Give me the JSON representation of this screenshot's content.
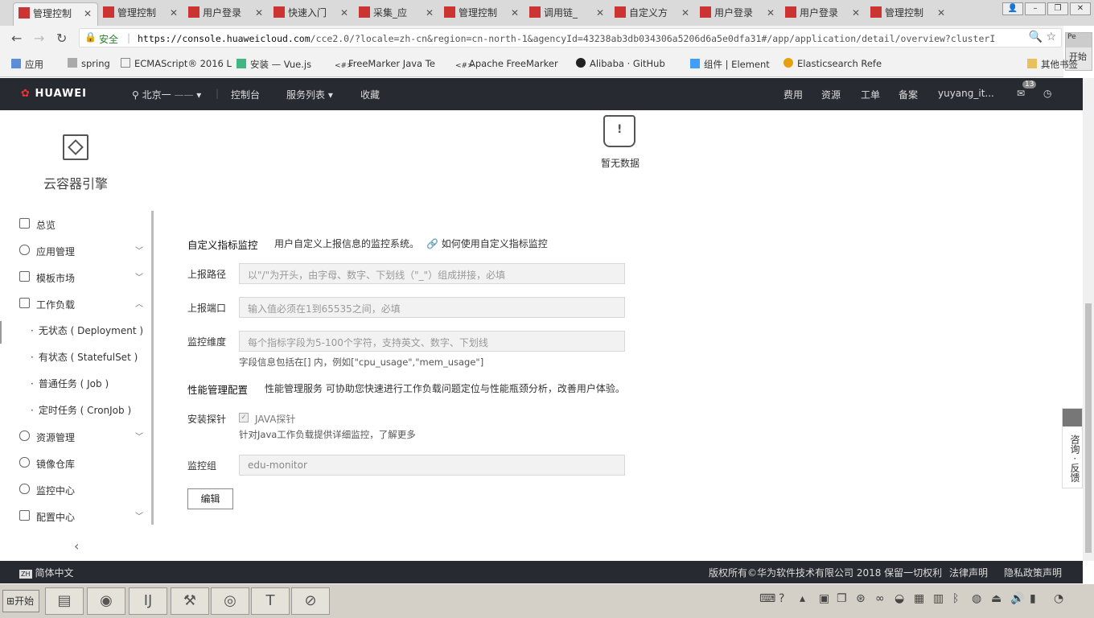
{
  "browser": {
    "tabs": [
      "管理控制",
      "管理控制",
      "用户登录",
      "快速入门",
      "采集_应",
      "管理控制",
      "调用链_",
      "自定义方",
      "用户登录",
      "用户登录",
      "管理控制"
    ],
    "secure_label": "安全",
    "url_host": "https://console.huaweicloud.com",
    "url_path": "/cce2.0/?locale=zh-cn&region=cn-north-1&agencyId=43238ab3db034306a5206d6a5e0dfa31#/app/application/detail/overview?clusterI",
    "extension_label": "开始",
    "bookmarks": [
      "应用",
      "spring",
      "ECMAScript® 2016 L",
      "安装 — Vue.js",
      "FreeMarker Java Te",
      "Apache FreeMarker",
      "Alibaba · GitHub",
      "组件 | Element",
      "Elasticsearch Refe",
      "其他书签"
    ]
  },
  "topnav": {
    "logo": "HUAWEI",
    "region": "北京一",
    "console": "控制台",
    "services": "服务列表",
    "favorites": "收藏",
    "billing": "费用",
    "resources": "资源",
    "tickets": "工单",
    "filing": "备案",
    "user": "yuyang_it...",
    "message_count": "13"
  },
  "sidebar": {
    "service_name": "云容器引擎",
    "items": [
      {
        "label": "总览"
      },
      {
        "label": "应用管理"
      },
      {
        "label": "模板市场"
      },
      {
        "label": "工作负载"
      },
      {
        "label": "资源管理"
      },
      {
        "label": "镜像仓库"
      },
      {
        "label": "监控中心"
      },
      {
        "label": "配置中心"
      }
    ],
    "sub_items": [
      {
        "label": "无状态 ( Deployment )"
      },
      {
        "label": "有状态 ( StatefulSet )"
      },
      {
        "label": "普通任务 ( Job )"
      },
      {
        "label": "定时任务 ( CronJob )"
      }
    ]
  },
  "main": {
    "empty_text": "暂无数据",
    "custom_metrics": {
      "title": "自定义指标监控",
      "desc": "用户自定义上报信息的监控系统。",
      "help_link": "如何使用自定义指标监控",
      "path_label": "上报路径",
      "path_placeholder": "以\"/\"为开头，由字母、数字、下划线（\"_\"）组成拼接，必填",
      "port_label": "上报端口",
      "port_placeholder": "输入值必须在1到65535之间，必填",
      "dimension_label": "监控维度",
      "dimension_placeholder": "每个指标字段为5-100个字符，支持英文、数字、下划线",
      "dimension_hint": "字段信息包括在[] 内，例如[\"cpu_usage\",\"mem_usage\"]"
    },
    "apm": {
      "title": "性能管理配置",
      "desc": "性能管理服务 可协助您快速进行工作负载问题定位与性能瓶颈分析，改善用户体验。",
      "probe_label": "安装探针",
      "probe_option": "JAVA探针",
      "probe_hint": "针对Java工作负载提供详细监控，了解更多",
      "group_label": "监控组",
      "group_value": "edu-monitor",
      "edit_button": "编辑"
    }
  },
  "feedback": "咨询 · 反馈",
  "footer": {
    "lang": "简体中文",
    "copyright": "版权所有©华为软件技术有限公司 2018 保留一切权利",
    "legal": "法律声明",
    "privacy": "隐私政策声明"
  },
  "taskbar": {
    "start": "开始"
  }
}
